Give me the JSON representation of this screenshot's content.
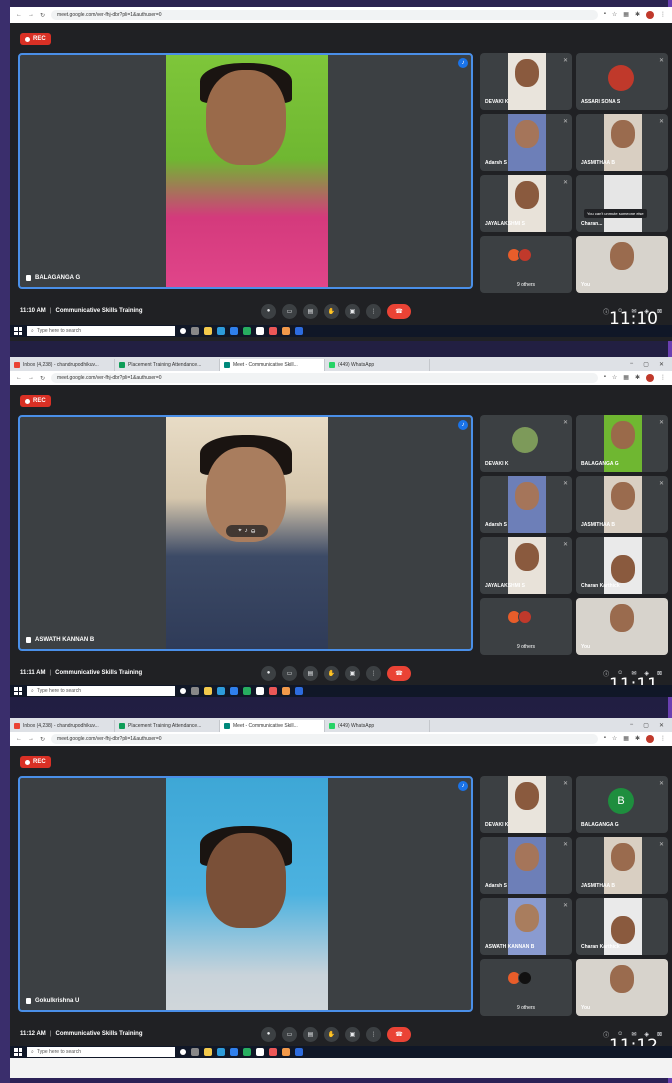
{
  "browser": {
    "url": "meet.google.com/ver-fhj-dbr?pli=1&authuser=0",
    "tabs": [
      {
        "label": "Inbox (4,238) - chandrupodhikuv...",
        "color": "#ea4335"
      },
      {
        "label": "Placement Training Attendance...",
        "color": "#0f9d58"
      },
      {
        "label": "Meet - Communicative Skill...",
        "color": "#00897b"
      },
      {
        "label": "(449) WhatsApp",
        "color": "#25d366"
      }
    ]
  },
  "rec_label": "REC",
  "meeting_title": "Communicative Skills Training",
  "taskbar": {
    "search_placeholder": "Type here to search"
  },
  "screens": [
    {
      "time": "11:10 AM",
      "clock_big": "11:10",
      "presenter": "BALAGANGA G",
      "tiles": [
        {
          "name": "DEVAKI K",
          "kind": "video"
        },
        {
          "name": "ASSARI SONA S",
          "kind": "video"
        },
        {
          "name": "Adarsh S",
          "kind": "video"
        },
        {
          "name": "JASMITHAA B",
          "kind": "video"
        },
        {
          "name": "JAYALAKSHMI S",
          "kind": "video"
        },
        {
          "name": "Charan...",
          "kind": "blank",
          "tooltip": "You can't unmute someone else"
        },
        {
          "name": "9 others",
          "kind": "others"
        },
        {
          "name": "You",
          "kind": "you"
        }
      ]
    },
    {
      "time": "11:11 AM",
      "clock_big": "11:11",
      "presenter": "ASWATH KANNAN B",
      "tiles": [
        {
          "name": "DEVAKI K",
          "kind": "video"
        },
        {
          "name": "BALAGANGA G",
          "kind": "video"
        },
        {
          "name": "Adarsh S",
          "kind": "video"
        },
        {
          "name": "JASMITHAA B",
          "kind": "video"
        },
        {
          "name": "JAYALAKSHMI S",
          "kind": "video"
        },
        {
          "name": "Charan Karthick",
          "kind": "blank"
        },
        {
          "name": "9 others",
          "kind": "others"
        },
        {
          "name": "You",
          "kind": "you"
        }
      ]
    },
    {
      "time": "11:12 AM",
      "clock_big": "11:12",
      "presenter": "Gokulkrishna U",
      "tiles": [
        {
          "name": "DEVAKI K",
          "kind": "video"
        },
        {
          "name": "BALAGANGA G",
          "kind": "letter",
          "letter": "B"
        },
        {
          "name": "Adarsh S",
          "kind": "video"
        },
        {
          "name": "JASMITHAA B",
          "kind": "video"
        },
        {
          "name": "ASWATH KANNAN B",
          "kind": "video"
        },
        {
          "name": "Charan Karthick",
          "kind": "blank"
        },
        {
          "name": "9 others",
          "kind": "others"
        },
        {
          "name": "You",
          "kind": "you"
        }
      ]
    }
  ],
  "colors": {
    "accent": "#4a8fe8",
    "end_call": "#ea4335",
    "rec": "#d93025",
    "bg": "#202124"
  }
}
